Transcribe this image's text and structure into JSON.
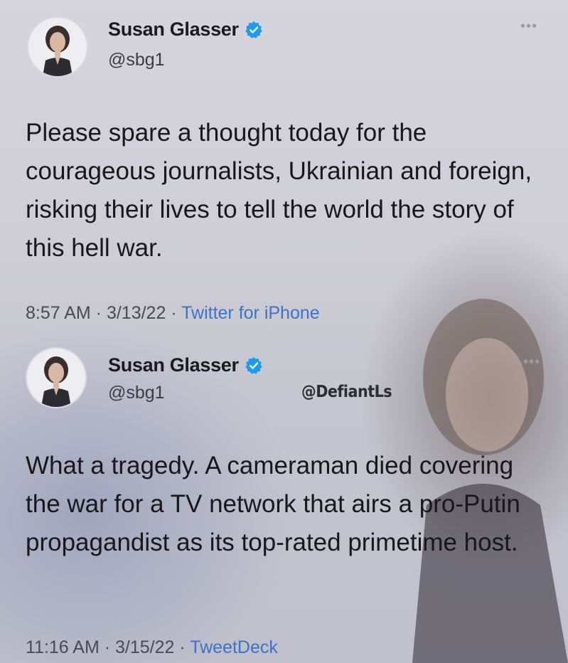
{
  "tweets": [
    {
      "name": "Susan Glasser",
      "handle": "@sbg1",
      "text": "Please spare a thought today for the courageous journalists, Ukrainian and foreign, risking their lives to tell the world the story of this hell war.",
      "time": "8:57 AM",
      "date": "3/13/22",
      "source": "Twitter for iPhone",
      "more_icon": "more-dots-icon",
      "verified_icon": "verified-badge-icon"
    },
    {
      "name": "Susan Glasser",
      "handle": "@sbg1",
      "watermark": "@DefiantLs",
      "text": "What a tragedy. A cameraman died covering the war for a TV network that airs a pro-Putin propagandist as its top-rated primetime host.",
      "time": "11:16 AM",
      "date": "3/15/22",
      "source": "TweetDeck",
      "more_icon": "more-dots-icon",
      "verified_icon": "verified-badge-icon"
    }
  ],
  "separator": " · ",
  "colors": {
    "verified": "#1d9bf0",
    "source_link": "#3b74c6",
    "text": "#17171c"
  }
}
